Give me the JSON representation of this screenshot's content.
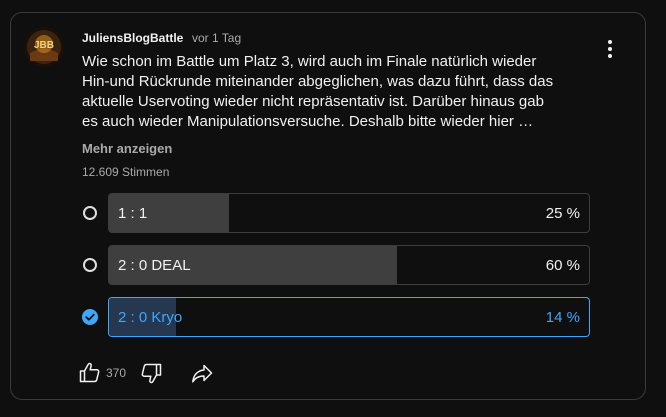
{
  "post": {
    "author": "JuliensBlogBattle",
    "time": "vor 1 Tag",
    "avatar_text": "JBB",
    "lines": [
      "Wie schon im Battle um Platz 3, wird auch im Finale natürlich wieder",
      "Hin-und Rückrunde miteinander abgeglichen, was dazu führt, dass das",
      "aktuelle Uservoting wieder nicht repräsentativ ist. Darüber hinaus gab",
      "es auch wieder Manipulationsversuche. Deshalb bitte wieder hier …"
    ],
    "show_more": "Mehr anzeigen"
  },
  "poll": {
    "votes": "12.609 Stimmen",
    "options": [
      {
        "label": "1 : 1",
        "percent_text": "25 %",
        "percent": 25,
        "selected": false
      },
      {
        "label": "2 : 0 DEAL",
        "percent_text": "60 %",
        "percent": 60,
        "selected": false
      },
      {
        "label": "2 : 0 Kryo",
        "percent_text": "14 %",
        "percent": 14,
        "selected": true
      }
    ]
  },
  "actions": {
    "like_count": "370",
    "like_icon": "thumbs-up-icon",
    "dislike_icon": "thumbs-down-icon",
    "share_icon": "share-icon"
  },
  "colors": {
    "accent": "#3ea6ff",
    "background": "#0f0f0f",
    "bar_fill": "#3f3f3f"
  }
}
